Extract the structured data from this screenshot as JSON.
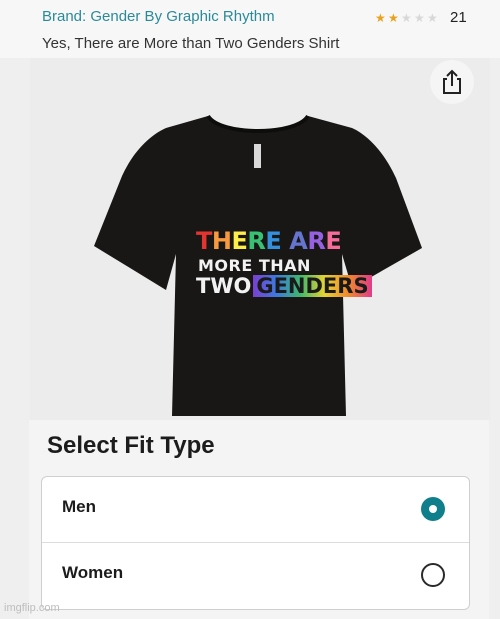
{
  "header": {
    "brand_link": "Brand: Gender By Graphic Rhythm",
    "rating": {
      "value": 2,
      "out_of": 5,
      "count": "21",
      "star_color": "#e9a21b"
    },
    "product_title": "Yes, There are More than Two Genders Shirt"
  },
  "product_image": {
    "share_icon": "share-icon",
    "shirt_color": "#181716",
    "shirt_text": {
      "line1": "THERE ARE",
      "line2": "MORE THAN",
      "line3_prefix": "TWO",
      "line3_highlight": "GENDERS"
    }
  },
  "fit": {
    "title": "Select Fit Type",
    "options": [
      {
        "label": "Men",
        "selected": true
      },
      {
        "label": "Women",
        "selected": false
      }
    ],
    "accent_color": "#0f7f8c"
  },
  "watermark": "imgflip.com"
}
